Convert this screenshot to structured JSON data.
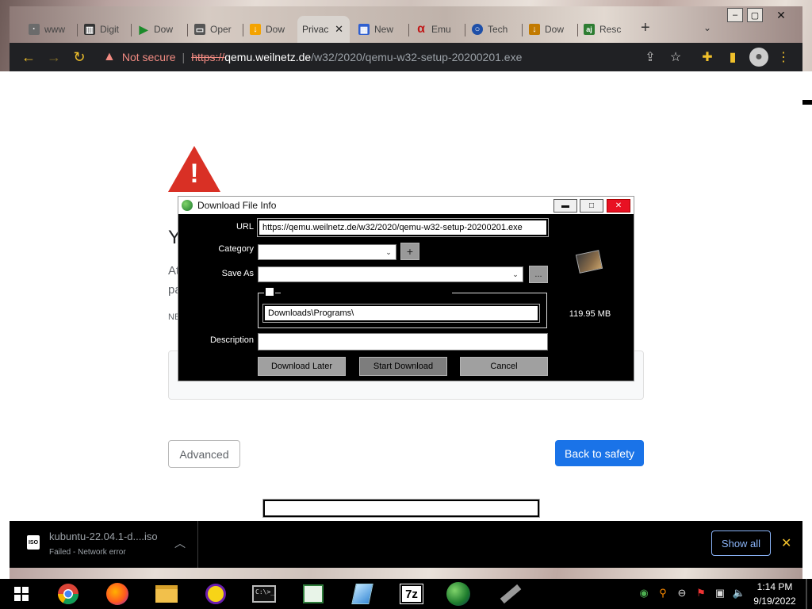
{
  "browser": {
    "tabs": [
      {
        "label": "www",
        "icon": "generic-page-icon"
      },
      {
        "label": "Digit",
        "icon": "library-icon"
      },
      {
        "label": "Dow",
        "icon": "play-icon"
      },
      {
        "label": "Oper",
        "icon": "folder-icon"
      },
      {
        "label": "Dow",
        "icon": "download-icon"
      },
      {
        "label": "Privac",
        "icon": "warning-icon",
        "active": true
      },
      {
        "label": "New",
        "icon": "newtab-icon"
      },
      {
        "label": "Emu",
        "icon": "alpha-icon"
      },
      {
        "label": "Tech",
        "icon": "tech-icon"
      },
      {
        "label": "Dow",
        "icon": "download-icon"
      },
      {
        "label": "Resc",
        "icon": "aj-icon"
      }
    ],
    "new_tab_glyph": "+",
    "address": {
      "security_label": "Not secure",
      "scheme": "https://",
      "host": "qemu.weilnetz.de",
      "path": "/w32/2020/qemu-w32-setup-20200201.exe"
    }
  },
  "page": {
    "advanced_label": "Advanced",
    "back_label": "Back to safety",
    "partial_heading": "Y",
    "partial_line1": "At",
    "partial_line2": "pa",
    "partial_line3": "NE"
  },
  "downloads": {
    "file_name": "kubuntu-22.04.1-d....iso",
    "status": "Failed - Network error",
    "show_all_label": "Show all",
    "file_type_label": "ISO"
  },
  "dialog": {
    "title": "Download File Info",
    "url_label": "URL",
    "url_value": "https://qemu.weilnetz.de/w32/2020/qemu-w32-setup-20200201.exe",
    "category_label": "Category",
    "category_value": "",
    "add_category_label": "+",
    "save_as_label": "Save As",
    "save_as_value": "",
    "browse_label": "...",
    "folder_value": "Downloads\\Programs\\",
    "description_label": "Description",
    "description_value": "",
    "file_size": "119.95 MB",
    "buttons": {
      "later": "Download Later",
      "start": "Start Download",
      "cancel": "Cancel"
    }
  },
  "taskbar": {
    "time": "1:14 PM",
    "date": "9/19/2022",
    "sevenzip_label": "7z",
    "cmd_label": "C:\\>_"
  },
  "colors": {
    "danger": "#d93025",
    "accent_blue": "#1a73e8",
    "chrome_dark": "#202124",
    "icon_yellow": "#f0c02b"
  }
}
